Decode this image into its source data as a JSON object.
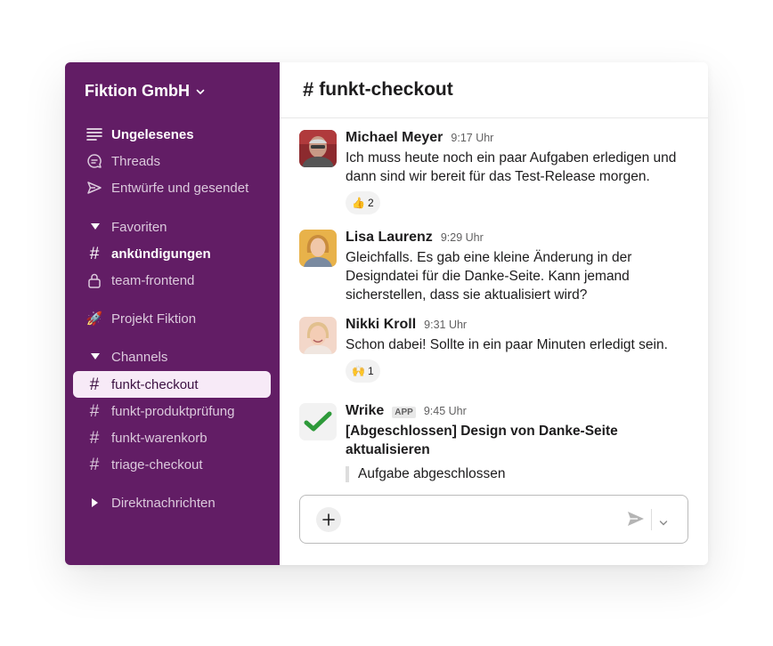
{
  "sidebar": {
    "workspace": "Fiktion GmbH",
    "top_items": [
      {
        "label": "Ungelesenes",
        "icon": "unread-icon"
      },
      {
        "label": "Threads",
        "icon": "threads-icon"
      },
      {
        "label": "Entwürfe und gesendet",
        "icon": "send-icon"
      }
    ],
    "favorites": {
      "title": "Favoriten",
      "items": [
        {
          "label": "ankündigungen",
          "icon": "hash-icon"
        },
        {
          "label": "team-frontend",
          "icon": "lock-icon"
        }
      ]
    },
    "project": {
      "label": "Projekt Fiktion",
      "icon": "rocket-icon"
    },
    "channels": {
      "title": "Channels",
      "items": [
        {
          "label": "funkt-checkout",
          "active": true
        },
        {
          "label": "funkt-produktprüfung"
        },
        {
          "label": "funkt-warenkorb"
        },
        {
          "label": "triage-checkout"
        }
      ]
    },
    "dms": {
      "title": "Direktnachrichten"
    }
  },
  "channel": {
    "hash": "#",
    "name": "funkt-checkout"
  },
  "messages": [
    {
      "name": "Michael Meyer",
      "time": "9:17 Uhr",
      "text": "Ich muss heute noch ein paar Aufgaben erledigen und dann sind wir bereit für das Test-Release morgen.",
      "reaction": {
        "emoji": "👍",
        "count": "2"
      }
    },
    {
      "name": "Lisa Laurenz",
      "time": "9:29 Uhr",
      "text": "Gleichfalls. Es gab eine kleine Änderung in der Designdatei für die Danke-Seite. Kann jemand sicherstellen, dass sie aktualisiert wird?"
    },
    {
      "name": "Nikki Kroll",
      "time": "9:31 Uhr",
      "text": "Schon dabei! Sollte in ein paar Minuten erledigt sein.",
      "reaction": {
        "emoji": "🙌",
        "count": "1"
      }
    },
    {
      "name": "Wrike",
      "badge": "APP",
      "time": "9:45 Uhr",
      "text": "[Abgeschlossen] Design von Danke-Seite aktualisieren",
      "quote": "Aufgabe abgeschlossen"
    }
  ],
  "colors": {
    "sidebar": "#621d65",
    "active_row": "#f7eaf7",
    "wrike_green": "#2e9a3a"
  }
}
